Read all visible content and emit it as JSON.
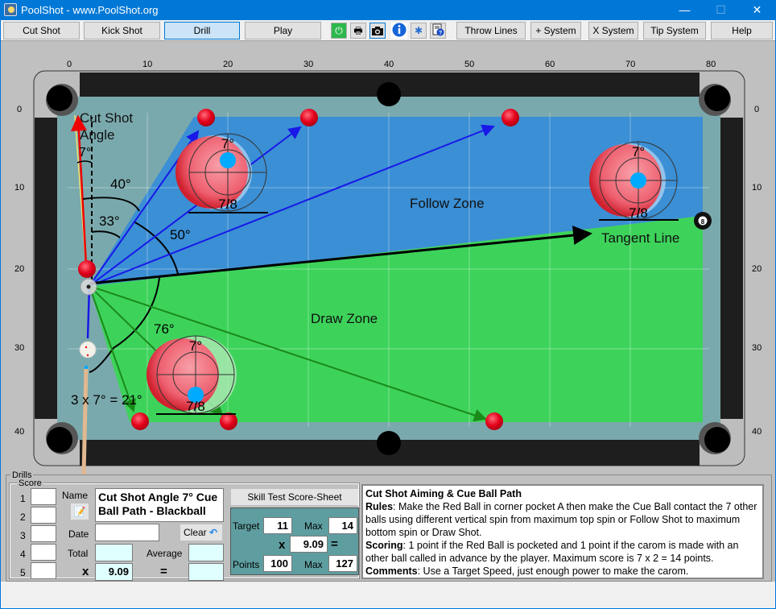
{
  "window": {
    "title": "PoolShot - www.PoolShot.org",
    "minimize": "—",
    "maximize": "☐",
    "close": "✕"
  },
  "toolbar": {
    "buttons": [
      {
        "label": "Cut Shot",
        "active": false
      },
      {
        "label": "Kick Shot",
        "active": false
      },
      {
        "label": "Drill",
        "active": true
      },
      {
        "label": "Play",
        "active": false
      },
      {
        "label": "Throw Lines",
        "active": false
      },
      {
        "label": "+ System",
        "active": false
      },
      {
        "label": "X System",
        "active": false
      },
      {
        "label": "Tip System",
        "active": false
      },
      {
        "label": "Help",
        "active": false
      }
    ],
    "icons": [
      "power-icon",
      "print-icon",
      "camera-icon",
      "info-icon",
      "settings-icon",
      "help-document-icon"
    ]
  },
  "table": {
    "x_ticks": [
      "0",
      "10",
      "20",
      "30",
      "40",
      "50",
      "60",
      "70",
      "80"
    ],
    "y_ticks": [
      "0",
      "10",
      "20",
      "30",
      "40"
    ],
    "labels": {
      "cut_shot_angle": "Cut Shot",
      "cut_shot_angle2": "Angle",
      "angle_7": "7°",
      "angle_40": "40°",
      "angle_33": "33°",
      "angle_50": "50°",
      "angle_76": "76°",
      "formula": "3 x 7° = 21°",
      "follow_zone": "Follow Zone",
      "draw_zone": "Draw Zone",
      "tangent_line": "Tangent Line",
      "ball_angle": "7°",
      "ball_fraction": "7/8",
      "eight_ball": "8"
    },
    "colors": {
      "follow_zone": "#3b8fd4",
      "draw_zone": "#3dd35a",
      "felt": "#7aa9ad",
      "rail": "#1e1e1e",
      "object_ball": "#e4001b",
      "cue_tip": "#00aaff"
    }
  },
  "drills": {
    "group_label": "Drills",
    "score_label": "Score",
    "rows": [
      "1",
      "2",
      "3",
      "4",
      "5"
    ],
    "name_label": "Name",
    "name_value": "Cut Shot Angle 7° Cue Ball Path - Blackball",
    "date_label": "Date",
    "date_value": "",
    "clear_label": "Clear",
    "total_label": "Total",
    "average_label": "Average",
    "x_label": "x",
    "multiplier": "9.09",
    "equals": "=",
    "skill_test_button": "Skill Test Score-Sheet",
    "target_label": "Target",
    "target_value": "11",
    "max_label": "Max",
    "max_value": "14",
    "multiplier2": "9.09",
    "points_label": "Points",
    "points_value": "100",
    "max2_label": "Max",
    "max2_value": "127"
  },
  "description": {
    "title": "Cut Shot Aiming & Cue Ball Path",
    "rules_label": "Rules",
    "rules_text": ": Make the Red Ball in corner pocket A then make the Cue Ball contact the 7 other balls using different vertical spin from maximum top spin or Follow Shot to maximum bottom spin or Draw Shot.",
    "scoring_label": "Scoring",
    "scoring_text": ": 1 point if the Red Ball is pocketed and 1 point if the carom is made with an other ball called in advance by the player. Maximum score is 7 x 2 = 14 points.",
    "comments_label": "Comments",
    "comments_text": ": Use a Target Speed, just enough power to make the carom."
  }
}
